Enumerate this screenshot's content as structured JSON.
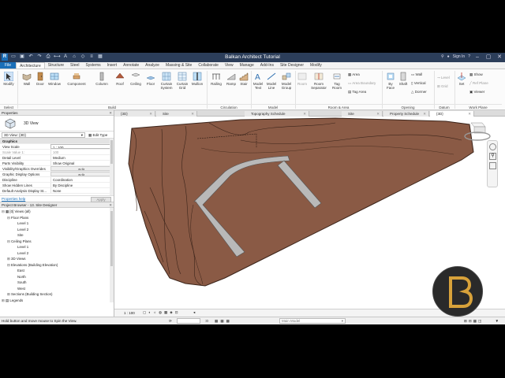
{
  "title_bar": {
    "app_title": "Balkan Architect Tutorial",
    "sign_in": "Sign In",
    "search_placeholder": "",
    "help": "?"
  },
  "ribbon_tabs": [
    "File",
    "Architecture",
    "Structure",
    "Steel",
    "Systems",
    "Insert",
    "Annotate",
    "Analyze",
    "Massing & Site",
    "Collaborate",
    "View",
    "Manage",
    "Add-Ins",
    "Site Designer",
    "Modify"
  ],
  "ribbon": {
    "modify": "Modify",
    "select": "Select",
    "build": [
      "Wall",
      "Door",
      "Window",
      "Component",
      "Column",
      "Roof",
      "Ceiling",
      "Floor",
      "Curtain System",
      "Curtain Grid",
      "Mullion"
    ],
    "build_label": "Build",
    "circulation": [
      "Railing",
      "Ramp",
      "Stair"
    ],
    "circulation_label": "Circulation",
    "model": [
      "Model Text",
      "Model Line",
      "Model Group"
    ],
    "model_label": "Model",
    "room_area": [
      "Room",
      "Room Separator",
      "Tag Room"
    ],
    "room_area_small": [
      "Area",
      "Area Boundary",
      "Tag Area"
    ],
    "room_area_label": "Room & Area",
    "opening": [
      "By Face",
      "Shaft"
    ],
    "opening_small": [
      "Wall",
      "Vertical",
      "Dormer"
    ],
    "opening_label": "Opening",
    "datum_small": [
      "Level",
      "Grid"
    ],
    "datum_label": "Datum",
    "workplane": "Set",
    "workplane_small": [
      "Show",
      "Ref Plane",
      "Viewer"
    ],
    "workplane_label": "Work Plane"
  },
  "view_tabs": [
    "{3D}",
    "Site",
    "Topography Schedule",
    "Site",
    "Property Schedule",
    "{3D}"
  ],
  "properties": {
    "header": "Properties",
    "type_name": "3D View",
    "selector": "3D View: {3D}",
    "edit_type": "Edit Type",
    "section": "Graphics",
    "rows": [
      {
        "k": "View Scale",
        "v": "1 : 100"
      },
      {
        "k": "Scale Value    1:",
        "v": "100"
      },
      {
        "k": "Detail Level",
        "v": "Medium"
      },
      {
        "k": "Parts Visibility",
        "v": "Show Original"
      },
      {
        "k": "Visibility/Graphics Overrides",
        "v": "Edit..."
      },
      {
        "k": "Graphic Display Options",
        "v": "Edit..."
      },
      {
        "k": "Discipline",
        "v": "Coordination"
      },
      {
        "k": "Show Hidden Lines",
        "v": "By Discipline"
      },
      {
        "k": "Default Analysis Display St...",
        "v": "None"
      }
    ],
    "help_link": "Properties help",
    "apply": "Apply"
  },
  "project_browser": {
    "header": "Project Browser - 13. Site Designer",
    "items": [
      {
        "t": "[0] Views (all)",
        "lvl": 0,
        "tg": "⊟"
      },
      {
        "t": "Floor Plans",
        "lvl": 1,
        "tg": "⊟"
      },
      {
        "t": "Level 1",
        "lvl": 2,
        "tg": ""
      },
      {
        "t": "Level 2",
        "lvl": 2,
        "tg": ""
      },
      {
        "t": "Site",
        "lvl": 2,
        "tg": ""
      },
      {
        "t": "Ceiling Plans",
        "lvl": 1,
        "tg": "⊟"
      },
      {
        "t": "Level 1",
        "lvl": 2,
        "tg": ""
      },
      {
        "t": "Level 2",
        "lvl": 2,
        "tg": ""
      },
      {
        "t": "3D Views",
        "lvl": 1,
        "tg": "⊞"
      },
      {
        "t": "Elevations (Building Elevation)",
        "lvl": 1,
        "tg": "⊟"
      },
      {
        "t": "East",
        "lvl": 2,
        "tg": ""
      },
      {
        "t": "North",
        "lvl": 2,
        "tg": ""
      },
      {
        "t": "South",
        "lvl": 2,
        "tg": ""
      },
      {
        "t": "West",
        "lvl": 2,
        "tg": ""
      },
      {
        "t": "Sections (Building Section)",
        "lvl": 1,
        "tg": "⊞"
      },
      {
        "t": "Legends",
        "lvl": 0,
        "tg": "⊞"
      }
    ]
  },
  "view_control": {
    "scale": "1 : 100"
  },
  "status_bar": {
    "message": "Hold button and move mouse to Spin the View.",
    "zero": ":0",
    "model": "Main Model"
  },
  "colors": {
    "accent": "#1b6fb8",
    "terrain": "#8a5a45",
    "road": "#b9b9b9"
  }
}
